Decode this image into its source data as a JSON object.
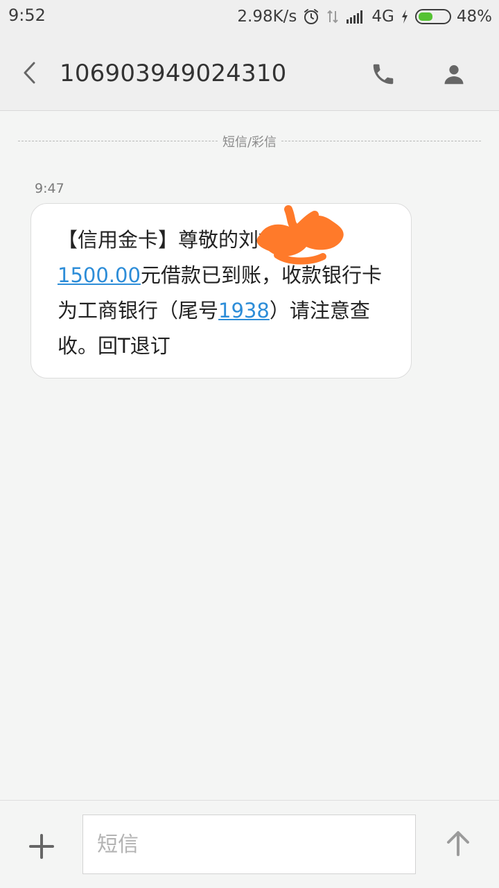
{
  "status_bar": {
    "time": "9:52",
    "network_speed": "2.98K/s",
    "network_type": "4G",
    "battery_percent": "48%",
    "battery_level": 0.48,
    "icons": [
      "alarm-icon",
      "data-arrows-icon",
      "signal-icon",
      "charging-icon",
      "battery-icon"
    ]
  },
  "header": {
    "sender_number": "106903949024310",
    "icons": [
      "back-icon",
      "phone-icon",
      "contact-icon"
    ]
  },
  "conversation": {
    "divider_label": "短信/彩信",
    "message": {
      "time": "9:47",
      "segments": {
        "prefix": "【信用金卡】尊敬的",
        "redacted_name": "刘**",
        "line1_suffix": "的",
        "amount": "1500.00",
        "body_mid": "元借款已到账，收款银行卡为工商银行（尾号",
        "card_tail": "1938",
        "body_end": "）请注意查收。回T退订"
      },
      "links": [
        "1500.00",
        "1938"
      ]
    }
  },
  "compose": {
    "placeholder": "短信",
    "value": "",
    "icons": [
      "add-icon",
      "send-icon"
    ]
  },
  "colors": {
    "link": "#2d8dd8",
    "battery_fill": "#55c233",
    "redaction": "#ff7a2a",
    "background": "#f4f5f4",
    "bubble": "#ffffff"
  }
}
